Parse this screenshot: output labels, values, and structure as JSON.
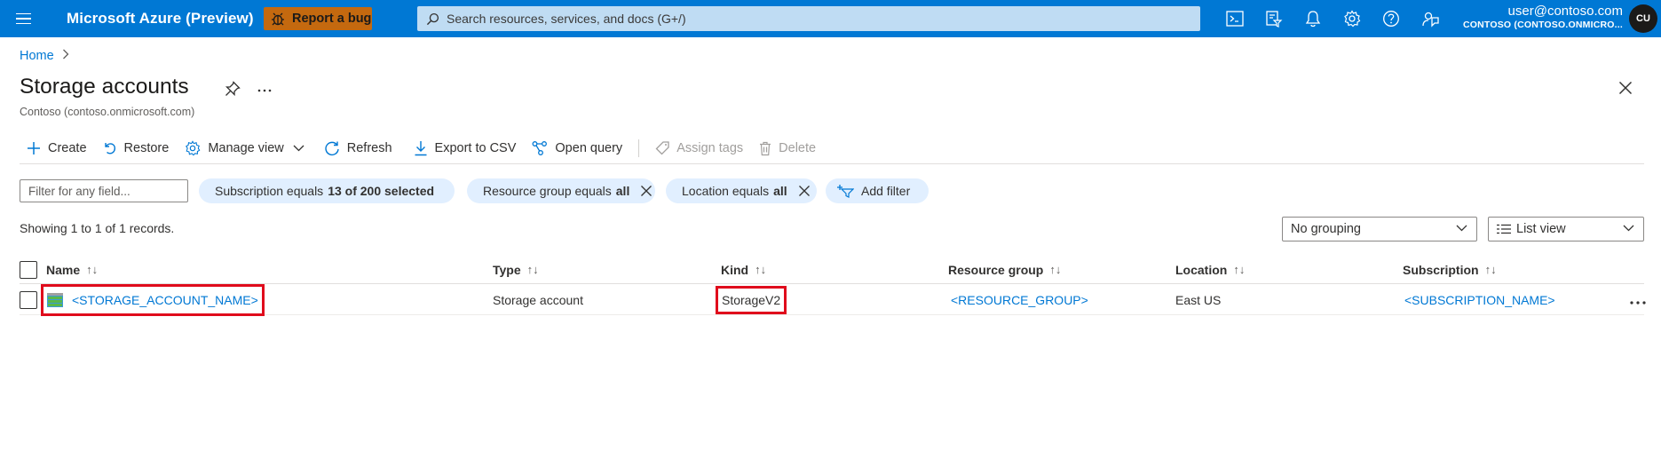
{
  "topbar": {
    "brand": "Microsoft Azure (Preview)",
    "report_bug": "Report a bug",
    "search_placeholder": "Search resources, services, and docs (G+/)",
    "user_email": "user@contoso.com",
    "user_tenant": "CONTOSO (CONTOSO.ONMICRO...",
    "avatar_initials": "CU",
    "icons": [
      "cloud-shell-icon",
      "directory-filter-icon",
      "notifications-bell-icon",
      "settings-gear-icon",
      "help-icon",
      "feedback-icon"
    ],
    "bar_color": "#0078d4",
    "bug_color": "#c4690f"
  },
  "breadcrumb": {
    "home": "Home"
  },
  "page": {
    "title": "Storage accounts",
    "subtitle": "Contoso (contoso.onmicrosoft.com)"
  },
  "toolbar": {
    "create": "Create",
    "restore": "Restore",
    "manage_view": "Manage view",
    "refresh": "Refresh",
    "export_csv": "Export to CSV",
    "open_query": "Open query",
    "assign_tags": "Assign tags",
    "delete": "Delete"
  },
  "filters": {
    "placeholder": "Filter for any field...",
    "subscription_prefix": "Subscription equals",
    "subscription_value": "13 of 200 selected",
    "resource_group_prefix": "Resource group equals",
    "resource_group_value": "all",
    "location_prefix": "Location equals",
    "location_value": "all",
    "add_filter": "Add filter"
  },
  "records_text": "Showing 1 to 1 of  1  records.",
  "grouping": {
    "selected": "No grouping"
  },
  "view": {
    "selected": "List view"
  },
  "table": {
    "columns": [
      "Name",
      "Type",
      "Kind",
      "Resource group",
      "Location",
      "Subscription"
    ],
    "rows": [
      {
        "name": "<STORAGE_ACCOUNT_NAME>",
        "type": "Storage account",
        "kind": "StorageV2",
        "resource_group": "<RESOURCE_GROUP>",
        "location": "East US",
        "subscription": "<SUBSCRIPTION_NAME>"
      }
    ]
  },
  "highlight_color": "#e00b1c"
}
